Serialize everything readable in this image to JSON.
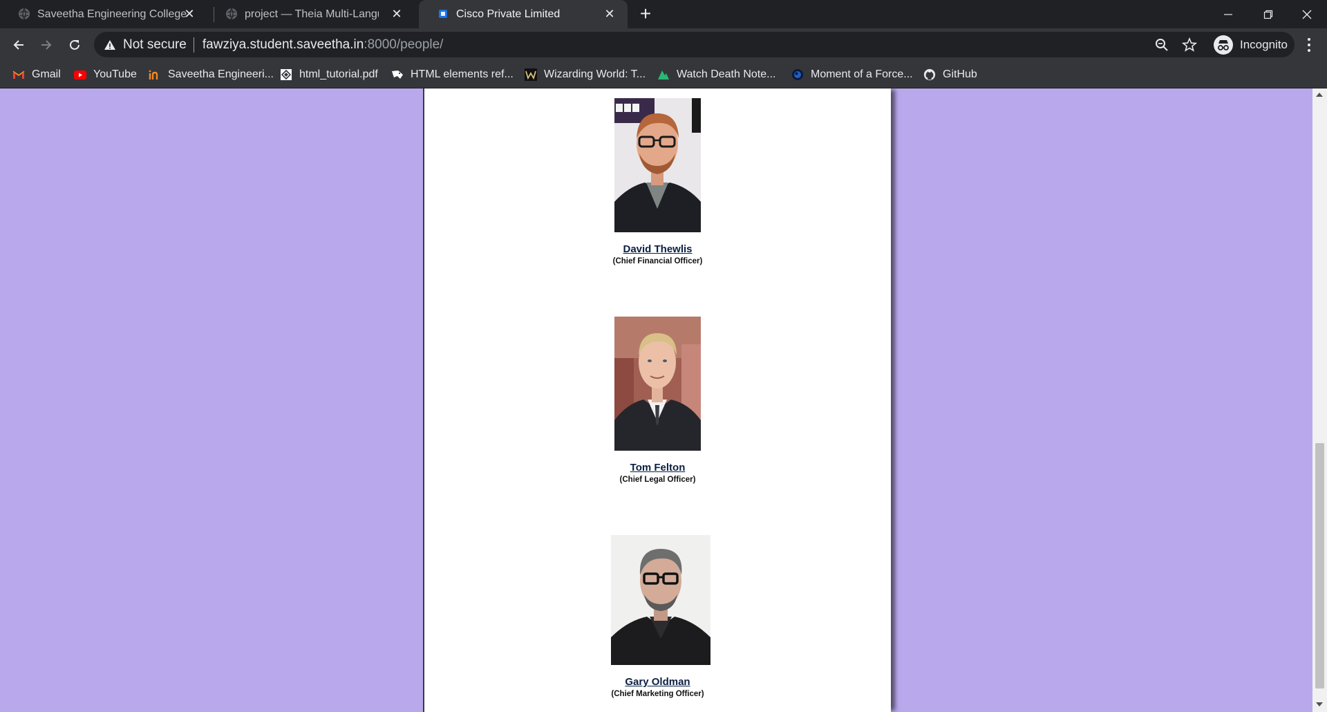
{
  "browser": {
    "tabs": [
      {
        "title": "Saveetha Engineering College",
        "favicon": "globe-icon",
        "active": false
      },
      {
        "title": "project — Theia Multi-Language",
        "favicon": "globe-icon",
        "active": false
      },
      {
        "title": "Cisco Private Limited",
        "favicon": "site-icon",
        "active": true
      }
    ],
    "address": {
      "security_label": "Not secure",
      "host": "fawziya.student.saveetha.in",
      "path": ":8000/people/"
    },
    "profile_label": "Incognito",
    "bookmarks": [
      {
        "label": "Gmail",
        "icon": "gmail-icon"
      },
      {
        "label": "YouTube",
        "icon": "youtube-icon"
      },
      {
        "label": "Saveetha Engineeri...",
        "icon": "saveetha-icon"
      },
      {
        "label": "html_tutorial.pdf",
        "icon": "pdf-icon"
      },
      {
        "label": "HTML elements ref...",
        "icon": "mdn-icon"
      },
      {
        "label": "Wizarding World: T...",
        "icon": "wizarding-icon"
      },
      {
        "label": "Watch Death Note...",
        "icon": "anime-icon"
      },
      {
        "label": "Moment of a Force...",
        "icon": "physics-icon"
      },
      {
        "label": "GitHub",
        "icon": "github-icon"
      }
    ]
  },
  "page": {
    "background_color": "#baa8ed",
    "people": [
      {
        "name": "David Thewlis",
        "role": "(Chief Financial Officer)"
      },
      {
        "name": "Tom Felton",
        "role": "(Chief Legal Officer)"
      },
      {
        "name": "Gary Oldman",
        "role": "(Chief Marketing Officer)"
      }
    ]
  }
}
